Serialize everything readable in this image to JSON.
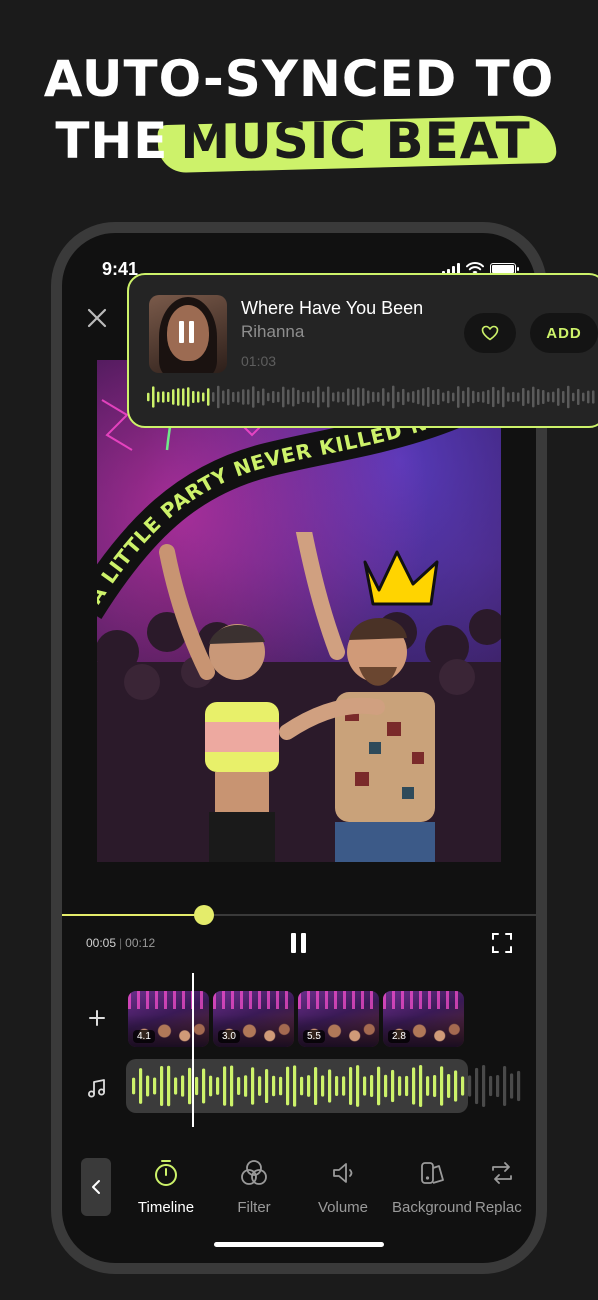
{
  "headline": {
    "line1": "AUTO-SYNCED TO",
    "line2_prefix": "THE",
    "line2_highlight": "MUSIC BEAT"
  },
  "status_bar": {
    "time": "9:41"
  },
  "video": {
    "banner_text": "A LITTLE PARTY NEVER KILLED NOBODY"
  },
  "music_card": {
    "title": "Where Have You Been",
    "artist": "Rihanna",
    "time": "01:03",
    "add_label": "ADD",
    "icons": {
      "album": "album-art",
      "heart": "heart-icon"
    }
  },
  "player": {
    "current_time": "00:05",
    "separator": "|",
    "total_time": "00:12",
    "progress": 0.3
  },
  "timeline": {
    "clips": [
      {
        "duration": "4.1"
      },
      {
        "duration": "3.0"
      },
      {
        "duration": "5.5"
      },
      {
        "duration": "2.8"
      }
    ]
  },
  "toolbar": {
    "items": [
      {
        "label": "Timeline",
        "icon": "timer-icon",
        "active": true
      },
      {
        "label": "Filter",
        "icon": "filter-icon",
        "active": false
      },
      {
        "label": "Volume",
        "icon": "volume-icon",
        "active": false
      },
      {
        "label": "Background",
        "icon": "background-icon",
        "active": false
      },
      {
        "label": "Replac",
        "icon": "replace-icon",
        "active": false
      }
    ]
  },
  "colors": {
    "accent": "#cdf26a",
    "progress": "#e4ec6b",
    "background": "#1b1b1b"
  }
}
